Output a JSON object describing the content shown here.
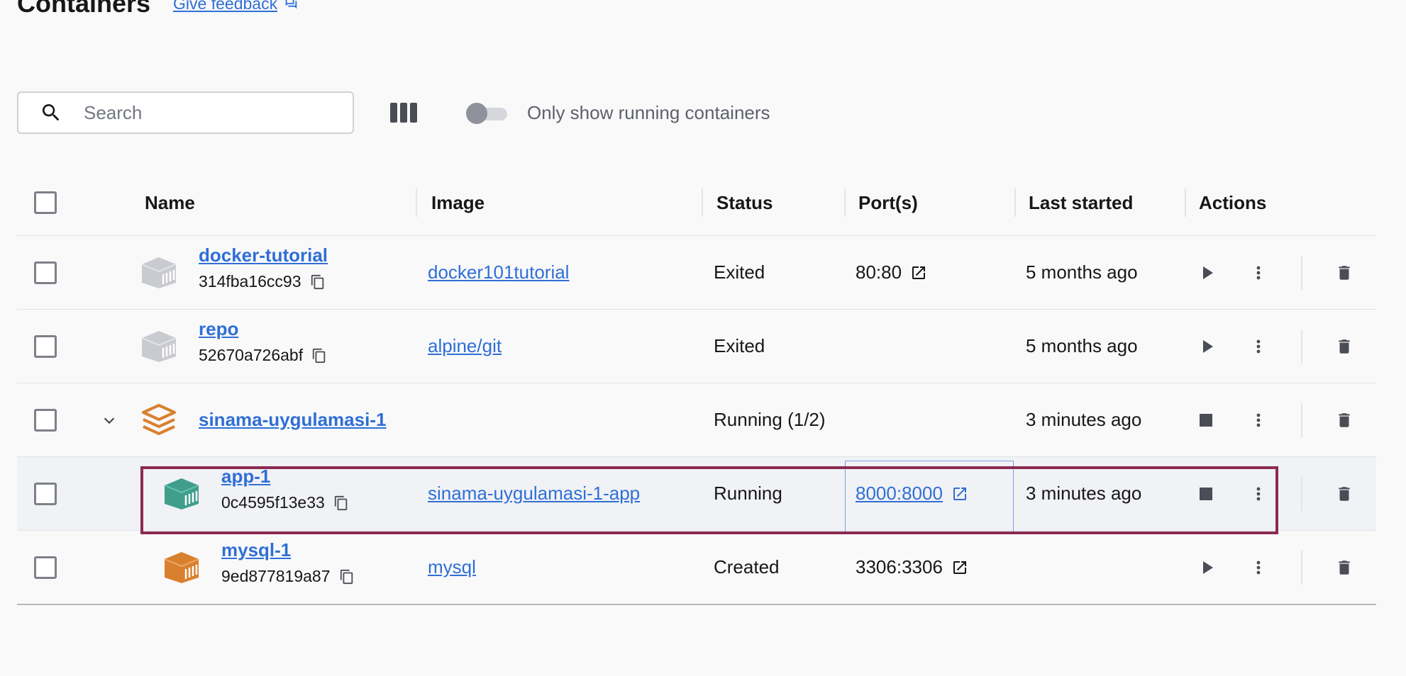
{
  "page": {
    "title": "Containers",
    "feedback_label": "Give feedback"
  },
  "toolbar": {
    "search_placeholder": "Search",
    "toggle_label": "Only show running containers",
    "toggle_on": false
  },
  "table": {
    "columns": [
      "Name",
      "Image",
      "Status",
      "Port(s)",
      "Last started",
      "Actions"
    ],
    "rows": [
      {
        "name": "docker-tutorial",
        "id": "314fba16cc93",
        "image": "docker101tutorial",
        "status": "Exited",
        "ports": "80:80",
        "last_started": "5 months ago",
        "action": "start"
      },
      {
        "name": "repo",
        "id": "52670a726abf",
        "image": "alpine/git",
        "status": "Exited",
        "ports": "",
        "last_started": "5 months ago",
        "action": "start"
      },
      {
        "name": "sinama-uygulamasi-1",
        "id": "",
        "image": "",
        "status": "Running (1/2)",
        "ports": "",
        "last_started": "3 minutes ago",
        "action": "stop",
        "group": true
      },
      {
        "name": "app-1",
        "id": "0c4595f13e33",
        "image": "sinama-uygulamasi-1-app",
        "status": "Running",
        "ports": "8000:8000",
        "last_started": "3 minutes ago",
        "action": "stop",
        "selected": true
      },
      {
        "name": "mysql-1",
        "id": "9ed877819a87",
        "image": "mysql",
        "status": "Created",
        "ports": "3306:3306",
        "last_started": "",
        "action": "start"
      }
    ]
  },
  "colors": {
    "link": "#2f6fd6",
    "running_icon": "#3f9e8c",
    "stopped_icon": "#c9cbd1",
    "stack_icon": "#d9802e",
    "created_icon": "#d9802e",
    "highlight_border": "#8b2a52"
  }
}
